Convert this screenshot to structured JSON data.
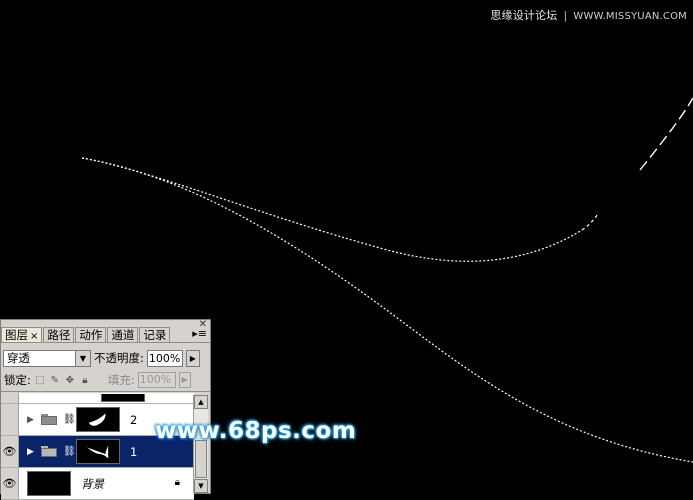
{
  "watermark": {
    "site_name": "思缘设计论坛",
    "site_url": "WWW.MISSYUAN.COM",
    "center_text": "www.68ps.com"
  },
  "colors": {
    "canvas_background": "#000000",
    "path_stroke": "#ffffff",
    "selected_layer": "#0a246a",
    "watermark_glow": "#29a8e0"
  },
  "layers_panel": {
    "tabs": [
      {
        "label": "图层",
        "close": "×",
        "active": true
      },
      {
        "label": "路径",
        "active": false
      },
      {
        "label": "动作",
        "active": false
      },
      {
        "label": "通道",
        "active": false
      },
      {
        "label": "记录",
        "active": false
      }
    ],
    "menu_icon": "panel-menu-icon",
    "blend_mode": "穿透",
    "opacity_label": "不透明度:",
    "opacity_value": "100%",
    "lock_label": "锁定:",
    "fill_label": "填充:",
    "fill_value": "100%",
    "layers": [
      {
        "name": "2",
        "type": "group",
        "visible": false,
        "selected": false
      },
      {
        "name": "1",
        "type": "group",
        "visible": true,
        "selected": true
      },
      {
        "name": "背景",
        "type": "background",
        "visible": true,
        "selected": false,
        "locked": true
      }
    ]
  }
}
